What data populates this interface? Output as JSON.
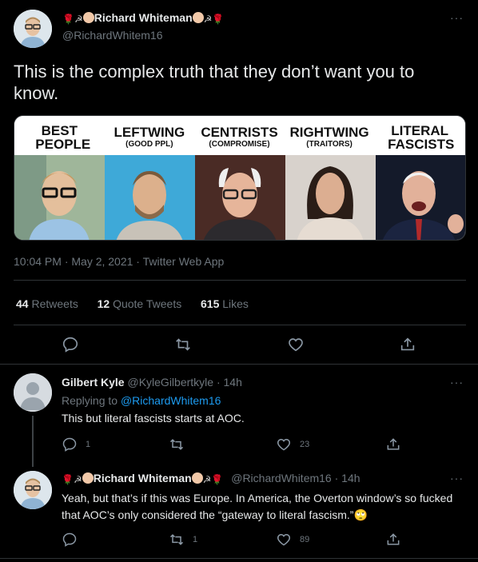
{
  "main_tweet": {
    "author": {
      "name": "Richard Whiteman",
      "handle": "@RichardWhitem16"
    },
    "text": "This is the complex truth that they don’t want you to know.",
    "image": {
      "panels": [
        {
          "title": "BEST PEOPLE",
          "subtitle": ""
        },
        {
          "title": "LEFTWING",
          "subtitle": "(GOOD PPL)"
        },
        {
          "title": "CENTRISTS",
          "subtitle": "(COMPROMISE)"
        },
        {
          "title": "RIGHTWING",
          "subtitle": "(TRAITORS)"
        },
        {
          "title": "LITERAL FASCISTS",
          "subtitle": ""
        }
      ]
    },
    "timestamp": "10:04 PM · May 2, 2021 · Twitter Web App",
    "stats": {
      "retweets": "44",
      "retweets_label": "Retweets",
      "quotes": "12",
      "quotes_label": "Quote Tweets",
      "likes": "615",
      "likes_label": "Likes"
    }
  },
  "reply1": {
    "name": "Gilbert Kyle",
    "handle": "@KyleGilbertkyle",
    "time": "· 14h",
    "replying_prefix": "Replying to",
    "replying_to": "@RichardWhitem16",
    "text": "This but literal fascists starts at AOC.",
    "reply_count": "1",
    "retweet_count": "",
    "like_count": "23"
  },
  "reply2": {
    "name": "Richard Whiteman",
    "handle": "@RichardWhitem16",
    "time": "· 14h",
    "text": "Yeah, but that’s if this was Europe.  In America, the Overton window’s so fucked that AOC’s only considered the “gateway to literal fascism.”",
    "emoji": "🙄",
    "reply_count": "",
    "retweet_count": "1",
    "like_count": "89"
  },
  "ui": {
    "more": "···",
    "emoji_rose": "🌹",
    "emoji_hammer": "☭"
  },
  "colors": {
    "background": "#000000",
    "link": "#1d9bf0",
    "muted": "#6e767d",
    "divider": "#2f3336"
  }
}
